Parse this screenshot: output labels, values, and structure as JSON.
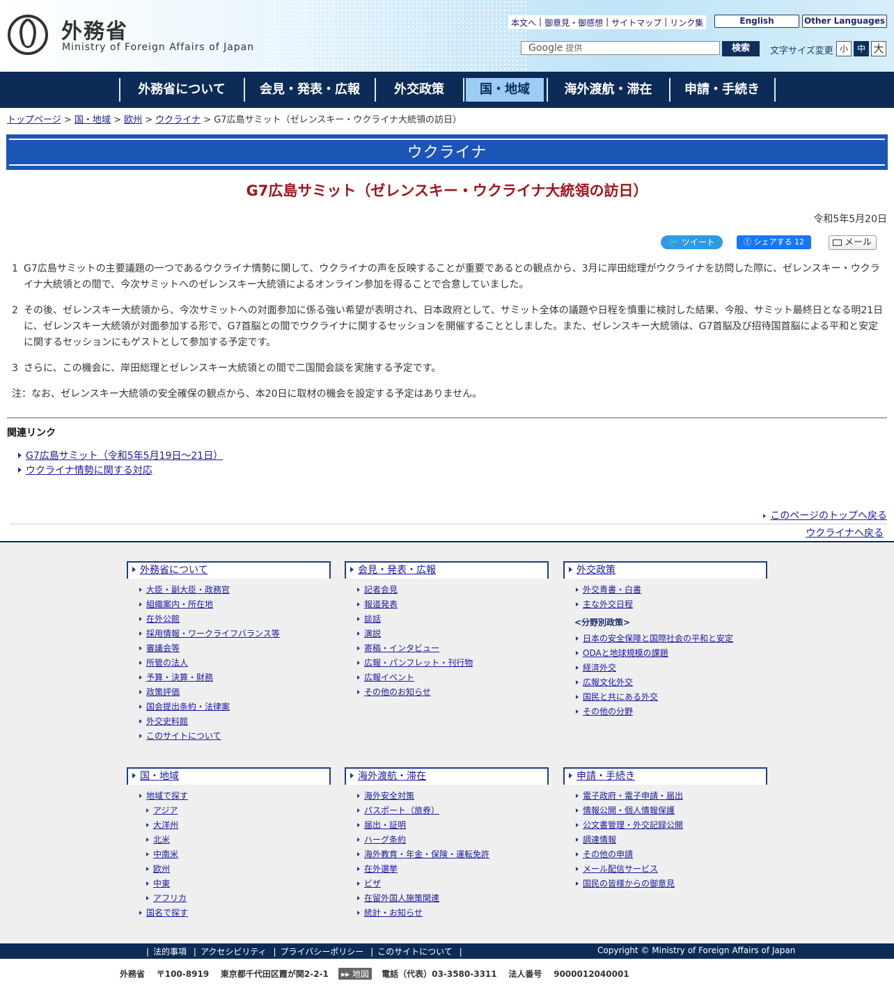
{
  "header": {
    "logo_ja": "外務省",
    "logo_en": "Ministry of Foreign Affairs of Japan",
    "util_links": [
      "本文へ",
      "御意見・御感想",
      "サイトマップ",
      "リンク集"
    ],
    "english": "English",
    "other_languages": "Other Languages",
    "search_provider": "Google",
    "search_placeholder": "提供",
    "search_button": "検索",
    "font_size_label": "文字サイズ変更",
    "font_small": "小",
    "font_mid": "中",
    "font_large": "大"
  },
  "nav": [
    "外務省について",
    "会見・発表・広報",
    "外交政策",
    "国・地域",
    "海外渡航・滞在",
    "申請・手続き"
  ],
  "breadcrumb": {
    "items": [
      "トップページ",
      "国・地域",
      "欧州",
      "ウクライナ"
    ],
    "current": "G7広島サミット（ゼレンスキー・ウクライナ大統領の訪日）"
  },
  "section_title": "ウクライナ",
  "page_title": "G7広島サミット（ゼレンスキー・ウクライナ大統領の訪日）",
  "date": "令和5年5月20日",
  "share": {
    "tweet": "ツイート",
    "facebook": "シェアする",
    "facebook_count": "12",
    "mail": "メール"
  },
  "paragraphs": [
    {
      "num": "1",
      "text": "G7広島サミットの主要議題の一つであるウクライナ情勢に関して、ウクライナの声を反映することが重要であるとの観点から、3月に岸田総理がウクライナを訪問した際に、ゼレンスキー・ウクライナ大統領との間で、今次サミットへのゼレンスキー大統領によるオンライン参加を得ることで合意していました。"
    },
    {
      "num": "2",
      "text": "その後、ゼレンスキー大統領から、今次サミットへの対面参加に係る強い希望が表明され、日本政府として、サミット全体の議題や日程を慎重に検討した結果、今般、サミット最終日となる明21日に、ゼレンスキー大統領が対面参加する形で、G7首脳との間でウクライナに関するセッションを開催することとしました。また、ゼレンスキー大統領は、G7首脳及び招待国首脳による平和と安定に関するセッションにもゲストとして参加する予定です。"
    },
    {
      "num": "3",
      "text": "さらに、この機会に、岸田総理とゼレンスキー大統領との間で二国間会談を実施する予定です。"
    }
  ],
  "note": "注：なお、ゼレンスキー大統領の安全確保の観点から、本20日に取材の機会を設定する予定はありません。",
  "related": {
    "title": "関連リンク",
    "links": [
      "G7広島サミット（令和5年5月19日～21日）",
      "ウクライナ情勢に関する対応"
    ]
  },
  "to_top": "このページのトップへ戻る",
  "back": "ウクライナへ戻る",
  "footer": {
    "col1": {
      "head": "外務省について",
      "items": [
        "大臣・副大臣・政務官",
        "組織案内・所在地",
        "在外公館",
        "採用情報・ワークライフバランス等",
        "審議会等",
        "所管の法人",
        "予算・決算・財務",
        "政策評価",
        "国会提出条約・法律案",
        "外交史料館",
        "このサイトについて"
      ]
    },
    "col2": {
      "head": "会見・発表・広報",
      "items": [
        "記者会見",
        "報道発表",
        "談話",
        "演説",
        "寄稿・インタビュー",
        "広報・パンフレット・刊行物",
        "広報イベント",
        "その他のお知らせ"
      ]
    },
    "col3": {
      "head": "外交政策",
      "items": [
        "外交青書・白書",
        "主な外交日程"
      ],
      "group": "<分野別政策>",
      "group_items": [
        "日本の安全保障と国際社会の平和と安定",
        "ODAと地球規模の課題",
        "経済外交",
        "広報文化外交",
        "国民と共にある外交",
        "その他の分野"
      ]
    },
    "col4": {
      "head": "国・地域",
      "first": "地域で探す",
      "regions": [
        "アジア",
        "大洋州",
        "北米",
        "中南米",
        "欧州",
        "中東",
        "アフリカ"
      ],
      "last": "国名で探す"
    },
    "col5": {
      "head": "海外渡航・滞在",
      "items": [
        "海外安全対策",
        "パスポート（旅券）",
        "届出・証明",
        "ハーグ条約",
        "海外教育・年金・保険・運転免許",
        "在外選挙",
        "ビザ",
        "在留外国人施策関連",
        "統計・お知らせ"
      ]
    },
    "col6": {
      "head": "申請・手続き",
      "items": [
        "電子政府・電子申請・届出",
        "情報公開・個人情報保護",
        "公文書管理・外交記録公開",
        "調達情報",
        "その他の申請",
        "メール配信サービス",
        "国民の皆様からの御意見"
      ]
    }
  },
  "bottom_links": [
    "法的事項",
    "アクセシビリティ",
    "プライバシーポリシー",
    "このサイトについて"
  ],
  "copyright": "Copyright © Ministry of Foreign Affairs of Japan",
  "address": {
    "name": "外務省",
    "postal": "〒100-8919",
    "addr": "東京都千代田区霞が関2-2-1",
    "map": "地図",
    "tel": "電話（代表）03-3580-3311",
    "corp_label": "法人番号",
    "corp_num": "9000012040001"
  }
}
